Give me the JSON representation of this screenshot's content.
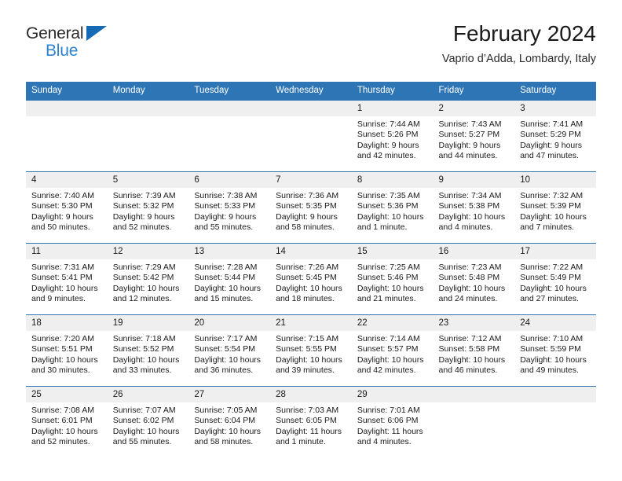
{
  "brand": {
    "word1": "General",
    "word2": "Blue",
    "triangle_color": "#1669b5",
    "blue_color": "#2e83d0"
  },
  "header": {
    "title": "February 2024",
    "location": "Vaprio d’Adda, Lombardy, Italy"
  },
  "theme": {
    "header_blue": "#2e75b6",
    "daynum_band": "#efefef",
    "text": "#1a1a1a"
  },
  "weekdays": [
    "Sunday",
    "Monday",
    "Tuesday",
    "Wednesday",
    "Thursday",
    "Friday",
    "Saturday"
  ],
  "weeks": [
    [
      {
        "day": "",
        "sunrise": "",
        "sunset": "",
        "daylight_line1": "",
        "daylight_line2": ""
      },
      {
        "day": "",
        "sunrise": "",
        "sunset": "",
        "daylight_line1": "",
        "daylight_line2": ""
      },
      {
        "day": "",
        "sunrise": "",
        "sunset": "",
        "daylight_line1": "",
        "daylight_line2": ""
      },
      {
        "day": "",
        "sunrise": "",
        "sunset": "",
        "daylight_line1": "",
        "daylight_line2": ""
      },
      {
        "day": "1",
        "sunrise": "Sunrise: 7:44 AM",
        "sunset": "Sunset: 5:26 PM",
        "daylight_line1": "Daylight: 9 hours",
        "daylight_line2": "and 42 minutes."
      },
      {
        "day": "2",
        "sunrise": "Sunrise: 7:43 AM",
        "sunset": "Sunset: 5:27 PM",
        "daylight_line1": "Daylight: 9 hours",
        "daylight_line2": "and 44 minutes."
      },
      {
        "day": "3",
        "sunrise": "Sunrise: 7:41 AM",
        "sunset": "Sunset: 5:29 PM",
        "daylight_line1": "Daylight: 9 hours",
        "daylight_line2": "and 47 minutes."
      }
    ],
    [
      {
        "day": "4",
        "sunrise": "Sunrise: 7:40 AM",
        "sunset": "Sunset: 5:30 PM",
        "daylight_line1": "Daylight: 9 hours",
        "daylight_line2": "and 50 minutes."
      },
      {
        "day": "5",
        "sunrise": "Sunrise: 7:39 AM",
        "sunset": "Sunset: 5:32 PM",
        "daylight_line1": "Daylight: 9 hours",
        "daylight_line2": "and 52 minutes."
      },
      {
        "day": "6",
        "sunrise": "Sunrise: 7:38 AM",
        "sunset": "Sunset: 5:33 PM",
        "daylight_line1": "Daylight: 9 hours",
        "daylight_line2": "and 55 minutes."
      },
      {
        "day": "7",
        "sunrise": "Sunrise: 7:36 AM",
        "sunset": "Sunset: 5:35 PM",
        "daylight_line1": "Daylight: 9 hours",
        "daylight_line2": "and 58 minutes."
      },
      {
        "day": "8",
        "sunrise": "Sunrise: 7:35 AM",
        "sunset": "Sunset: 5:36 PM",
        "daylight_line1": "Daylight: 10 hours",
        "daylight_line2": "and 1 minute."
      },
      {
        "day": "9",
        "sunrise": "Sunrise: 7:34 AM",
        "sunset": "Sunset: 5:38 PM",
        "daylight_line1": "Daylight: 10 hours",
        "daylight_line2": "and 4 minutes."
      },
      {
        "day": "10",
        "sunrise": "Sunrise: 7:32 AM",
        "sunset": "Sunset: 5:39 PM",
        "daylight_line1": "Daylight: 10 hours",
        "daylight_line2": "and 7 minutes."
      }
    ],
    [
      {
        "day": "11",
        "sunrise": "Sunrise: 7:31 AM",
        "sunset": "Sunset: 5:41 PM",
        "daylight_line1": "Daylight: 10 hours",
        "daylight_line2": "and 9 minutes."
      },
      {
        "day": "12",
        "sunrise": "Sunrise: 7:29 AM",
        "sunset": "Sunset: 5:42 PM",
        "daylight_line1": "Daylight: 10 hours",
        "daylight_line2": "and 12 minutes."
      },
      {
        "day": "13",
        "sunrise": "Sunrise: 7:28 AM",
        "sunset": "Sunset: 5:44 PM",
        "daylight_line1": "Daylight: 10 hours",
        "daylight_line2": "and 15 minutes."
      },
      {
        "day": "14",
        "sunrise": "Sunrise: 7:26 AM",
        "sunset": "Sunset: 5:45 PM",
        "daylight_line1": "Daylight: 10 hours",
        "daylight_line2": "and 18 minutes."
      },
      {
        "day": "15",
        "sunrise": "Sunrise: 7:25 AM",
        "sunset": "Sunset: 5:46 PM",
        "daylight_line1": "Daylight: 10 hours",
        "daylight_line2": "and 21 minutes."
      },
      {
        "day": "16",
        "sunrise": "Sunrise: 7:23 AM",
        "sunset": "Sunset: 5:48 PM",
        "daylight_line1": "Daylight: 10 hours",
        "daylight_line2": "and 24 minutes."
      },
      {
        "day": "17",
        "sunrise": "Sunrise: 7:22 AM",
        "sunset": "Sunset: 5:49 PM",
        "daylight_line1": "Daylight: 10 hours",
        "daylight_line2": "and 27 minutes."
      }
    ],
    [
      {
        "day": "18",
        "sunrise": "Sunrise: 7:20 AM",
        "sunset": "Sunset: 5:51 PM",
        "daylight_line1": "Daylight: 10 hours",
        "daylight_line2": "and 30 minutes."
      },
      {
        "day": "19",
        "sunrise": "Sunrise: 7:18 AM",
        "sunset": "Sunset: 5:52 PM",
        "daylight_line1": "Daylight: 10 hours",
        "daylight_line2": "and 33 minutes."
      },
      {
        "day": "20",
        "sunrise": "Sunrise: 7:17 AM",
        "sunset": "Sunset: 5:54 PM",
        "daylight_line1": "Daylight: 10 hours",
        "daylight_line2": "and 36 minutes."
      },
      {
        "day": "21",
        "sunrise": "Sunrise: 7:15 AM",
        "sunset": "Sunset: 5:55 PM",
        "daylight_line1": "Daylight: 10 hours",
        "daylight_line2": "and 39 minutes."
      },
      {
        "day": "22",
        "sunrise": "Sunrise: 7:14 AM",
        "sunset": "Sunset: 5:57 PM",
        "daylight_line1": "Daylight: 10 hours",
        "daylight_line2": "and 42 minutes."
      },
      {
        "day": "23",
        "sunrise": "Sunrise: 7:12 AM",
        "sunset": "Sunset: 5:58 PM",
        "daylight_line1": "Daylight: 10 hours",
        "daylight_line2": "and 46 minutes."
      },
      {
        "day": "24",
        "sunrise": "Sunrise: 7:10 AM",
        "sunset": "Sunset: 5:59 PM",
        "daylight_line1": "Daylight: 10 hours",
        "daylight_line2": "and 49 minutes."
      }
    ],
    [
      {
        "day": "25",
        "sunrise": "Sunrise: 7:08 AM",
        "sunset": "Sunset: 6:01 PM",
        "daylight_line1": "Daylight: 10 hours",
        "daylight_line2": "and 52 minutes."
      },
      {
        "day": "26",
        "sunrise": "Sunrise: 7:07 AM",
        "sunset": "Sunset: 6:02 PM",
        "daylight_line1": "Daylight: 10 hours",
        "daylight_line2": "and 55 minutes."
      },
      {
        "day": "27",
        "sunrise": "Sunrise: 7:05 AM",
        "sunset": "Sunset: 6:04 PM",
        "daylight_line1": "Daylight: 10 hours",
        "daylight_line2": "and 58 minutes."
      },
      {
        "day": "28",
        "sunrise": "Sunrise: 7:03 AM",
        "sunset": "Sunset: 6:05 PM",
        "daylight_line1": "Daylight: 11 hours",
        "daylight_line2": "and 1 minute."
      },
      {
        "day": "29",
        "sunrise": "Sunrise: 7:01 AM",
        "sunset": "Sunset: 6:06 PM",
        "daylight_line1": "Daylight: 11 hours",
        "daylight_line2": "and 4 minutes."
      },
      {
        "day": "",
        "sunrise": "",
        "sunset": "",
        "daylight_line1": "",
        "daylight_line2": ""
      },
      {
        "day": "",
        "sunrise": "",
        "sunset": "",
        "daylight_line1": "",
        "daylight_line2": ""
      }
    ]
  ]
}
